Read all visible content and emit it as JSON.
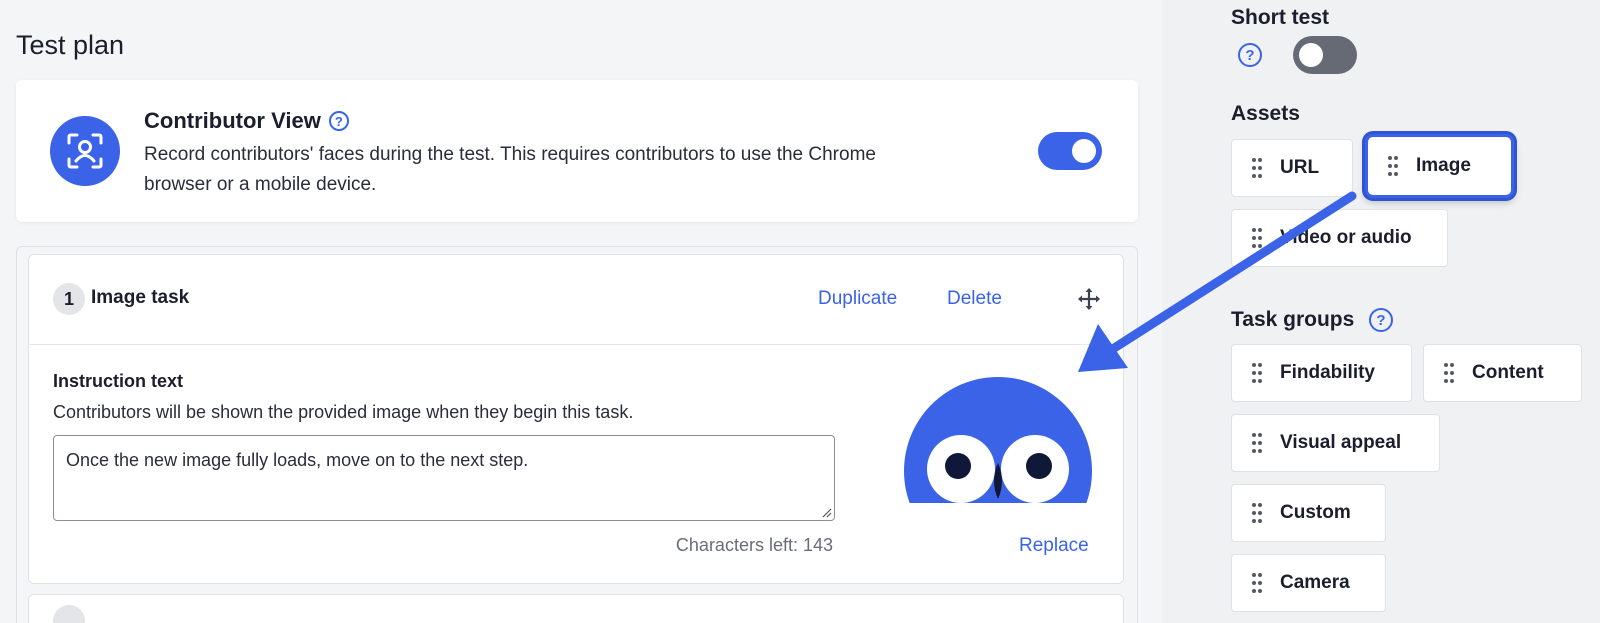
{
  "page": {
    "title": "Test plan"
  },
  "contributor_view": {
    "title": "Contributor View",
    "description": "Record contributors' faces during the test. This requires contributors to use the Chrome browser or a mobile device.",
    "enabled": true,
    "icon": "face-scan-icon"
  },
  "task": {
    "number": "1",
    "name": "Image task",
    "duplicate_label": "Duplicate",
    "delete_label": "Delete",
    "instruction_label": "Instruction text",
    "instruction_desc": "Contributors will be shown the provided image when they begin this task.",
    "instruction_value": "Once the new image fully loads, move on to the next step.",
    "chars_left": "Characters left: 143",
    "replace_label": "Replace"
  },
  "sidebar": {
    "short_test_label": "Short test",
    "short_test_enabled": false,
    "assets_label": "Assets",
    "assets": [
      {
        "label": "URL"
      },
      {
        "label": "Image"
      },
      {
        "label": "Video or audio"
      }
    ],
    "task_groups_label": "Task groups",
    "task_groups": [
      {
        "label": "Findability"
      },
      {
        "label": "Content"
      },
      {
        "label": "Visual appeal"
      },
      {
        "label": "Custom"
      },
      {
        "label": "Camera"
      }
    ]
  },
  "colors": {
    "accent": "#3b63e8",
    "toggle_off": "#656a75"
  }
}
